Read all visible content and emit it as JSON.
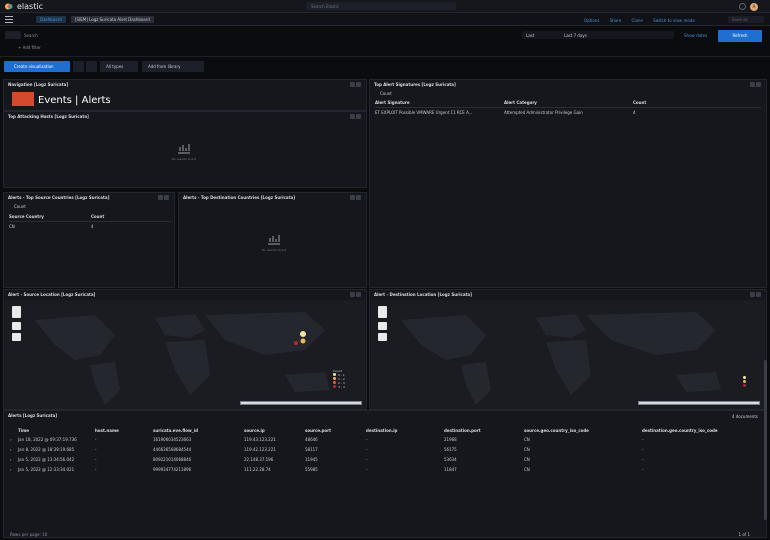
{
  "topbar": {
    "brand": "elastic",
    "search_placeholder": "Search Elastic",
    "avatar_initial": "A"
  },
  "navbar": {
    "crumb_dashboard": "Dashboard",
    "crumb_current": "[SIEM] Logz Suricata Alert Dashboard",
    "actions": [
      "Options",
      "Share",
      "Clone",
      "Switch to view mode"
    ],
    "save_label": "Save as"
  },
  "query": {
    "placeholder": "Search",
    "date_quick": "Last",
    "date_range": "Last 7 days",
    "show_dates": "Show dates",
    "refresh": "Refresh",
    "add_filter": "+ Add filter"
  },
  "toolbar": {
    "create": "Create visualization",
    "all_types": "All types",
    "add_library": "Add from library"
  },
  "panels": {
    "navigation": {
      "title": "Navigation [Logz Suricata]",
      "events": "Events",
      "alerts": "Alerts",
      "separator": "|"
    },
    "top_sig": {
      "title": "Top Alert Signatures [Logz Suricata]",
      "control": "Count",
      "headers": [
        "Alert Signature",
        "Alert Category",
        "Count"
      ],
      "rows": [
        [
          "ET EXPLOIT Possible VMWARE Urgent 11 RCE A...",
          "Attempted Administrator Privilege Gain",
          "4"
        ]
      ]
    },
    "top_hosts": {
      "title": "Top Attacking Hosts [Logz Suricata]",
      "no_results": "No results found"
    },
    "top_source": {
      "title": "Alerts - Top Source Countries [Logz Suricata]",
      "control": "Count",
      "headers": [
        "Source Country",
        "Count"
      ],
      "rows": [
        [
          "CN",
          "4"
        ]
      ]
    },
    "top_dest": {
      "title": "Alerts - Top Destination Countries [Logz Suricata]",
      "no_results": "No results found"
    },
    "source_map": {
      "title": "Alert - Source Location [Logz Suricata]",
      "legend_title": "Count",
      "legend": [
        "0 - 1",
        "1 - 2",
        "2 - 3",
        "3 - 4"
      ]
    },
    "dest_map": {
      "title": "Alert - Destination Location [Logz Suricata]"
    },
    "alerts": {
      "title": "Alerts [Logz Suricata]",
      "docs": "4 documents",
      "headers": [
        "Time",
        "host.name",
        "suricata.eve.flow_id",
        "source.ip",
        "source.port",
        "destination.ip",
        "destination.port",
        "source.geo.country_iso_code",
        "destination.geo.country_iso_code"
      ],
      "rows": [
        [
          "Jan 18, 2022 @ 09:37:19.736",
          "-",
          "161906034523663",
          "119.43.123.221",
          "48646",
          "-",
          "21968",
          "CN",
          "-"
        ],
        [
          "Jan 8, 2022 @ 18:39:19.685",
          "-",
          "446636568684544",
          "119.42.123.221",
          "58117",
          "-",
          "56175",
          "CN",
          "-"
        ],
        [
          "Jan 5, 2022 @ 13:34:56.042",
          "-",
          "809221014068846",
          "22.148.37.196",
          "11945",
          "-",
          "53634",
          "CN",
          "-"
        ],
        [
          "Jan 5, 2022 @ 12:33:34.021",
          "-",
          "999934774211896",
          "111.22.28.74",
          "55985",
          "-",
          "11847",
          "CN",
          "-"
        ]
      ],
      "rows_per_page": "Rows per page: 10",
      "pager": "1 of 1"
    }
  },
  "colors": {
    "accent": "#1f6fd1",
    "link": "#4a90d6",
    "legend": [
      "#f0e4a8",
      "#e8b85a",
      "#d9603f",
      "#b3282d"
    ]
  }
}
